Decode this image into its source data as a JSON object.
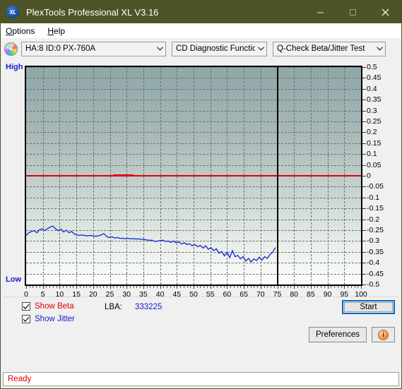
{
  "window": {
    "title": "PlexTools Professional XL V3.16",
    "app_icon": "xl-disc-icon",
    "minimize_label": "—",
    "maximize_label": "□",
    "close_label": "✕"
  },
  "menu": {
    "items": [
      {
        "label": "Options",
        "accel": "O"
      },
      {
        "label": "Help",
        "accel": "H"
      }
    ]
  },
  "toolbar": {
    "drive_icon": "cd-disc-icon",
    "drive_select": "HA:8 ID:0  PX-760A",
    "function_select": "CD Diagnostic Functions",
    "test_select": "Q-Check Beta/Jitter Test"
  },
  "chart_labels": {
    "high": "High",
    "low": "Low"
  },
  "controls": {
    "show_beta_label": "Show Beta",
    "show_beta_checked": true,
    "show_jitter_label": "Show Jitter",
    "show_jitter_checked": true,
    "lba_label": "LBA:",
    "lba_value": "333225",
    "start_label": "Start",
    "preferences_label": "Preferences",
    "info_label": "i"
  },
  "status": {
    "text": "Ready"
  },
  "colors": {
    "titlebar": "#4e5426",
    "beta_line": "#e00000",
    "jitter_line": "#1f2fd0",
    "label_blue": "#1818d0",
    "status_red": "#e00000",
    "plot_top": "#8fa7a8",
    "plot_bottom": "#fcfdfc"
  },
  "chart_data": {
    "type": "line",
    "title": "Q-Check Beta/Jitter Test",
    "xlabel": "",
    "ylabel": "",
    "xlim": [
      0,
      100
    ],
    "ylim": [
      -0.5,
      0.5
    ],
    "grid": true,
    "legend_position": "none",
    "xticks": [
      0,
      5,
      10,
      15,
      20,
      25,
      30,
      35,
      40,
      45,
      50,
      55,
      60,
      65,
      70,
      75,
      80,
      85,
      90,
      95,
      100
    ],
    "yticks": [
      0.5,
      0.45,
      0.4,
      0.35,
      0.3,
      0.25,
      0.2,
      0.15,
      0.1,
      0.05,
      0,
      -0.05,
      -0.1,
      -0.15,
      -0.2,
      -0.25,
      -0.3,
      -0.35,
      -0.4,
      -0.45,
      -0.5
    ],
    "annotations": [
      {
        "type": "vline",
        "x": 74.8,
        "color": "#000000",
        "label": "data-end-marker"
      }
    ],
    "series": [
      {
        "name": "Beta",
        "color": "#e00000",
        "type": "line",
        "x": [
          0,
          100
        ],
        "values": [
          0,
          0
        ],
        "note": "flat beta trace at 0 across full width"
      },
      {
        "name": "Jitter",
        "color": "#1f2fd0",
        "type": "line",
        "x": [
          0,
          0.8,
          1.6,
          2.4,
          3.2,
          4,
          4.8,
          5.6,
          6.4,
          7.2,
          8,
          8.8,
          9.6,
          10.4,
          11.2,
          12,
          12.8,
          13.6,
          14.4,
          15.2,
          16,
          16.8,
          17.6,
          18.4,
          19.2,
          20,
          20.8,
          21.6,
          22.4,
          23.2,
          24,
          24.8,
          25.6,
          26.4,
          27.2,
          28,
          28.8,
          29.6,
          30.4,
          31.2,
          32,
          32.8,
          33.6,
          34.4,
          35.2,
          36,
          36.8,
          37.6,
          38.4,
          39.2,
          40,
          40.8,
          41.6,
          42.4,
          43.2,
          44,
          44.8,
          45.6,
          46.4,
          47.2,
          48,
          48.8,
          49.6,
          50.4,
          51.2,
          52,
          52.8,
          53.6,
          54.4,
          55.2,
          56,
          56.8,
          57.6,
          58.4,
          59.2,
          60,
          60.8,
          61.6,
          62.4,
          63.2,
          64,
          64.8,
          65.6,
          66.4,
          67.2,
          68,
          68.8,
          69.6,
          70.4,
          71.2,
          72,
          72.8,
          73.6,
          74.4
        ],
        "values": [
          -0.275,
          -0.262,
          -0.256,
          -0.252,
          -0.262,
          -0.248,
          -0.244,
          -0.252,
          -0.243,
          -0.236,
          -0.231,
          -0.244,
          -0.252,
          -0.245,
          -0.258,
          -0.25,
          -0.262,
          -0.256,
          -0.268,
          -0.272,
          -0.274,
          -0.272,
          -0.275,
          -0.276,
          -0.274,
          -0.277,
          -0.278,
          -0.276,
          -0.272,
          -0.266,
          -0.278,
          -0.284,
          -0.28,
          -0.286,
          -0.284,
          -0.288,
          -0.287,
          -0.289,
          -0.288,
          -0.29,
          -0.289,
          -0.291,
          -0.29,
          -0.292,
          -0.293,
          -0.295,
          -0.297,
          -0.296,
          -0.302,
          -0.3,
          -0.298,
          -0.296,
          -0.302,
          -0.3,
          -0.306,
          -0.3,
          -0.308,
          -0.304,
          -0.314,
          -0.308,
          -0.316,
          -0.312,
          -0.322,
          -0.316,
          -0.326,
          -0.32,
          -0.332,
          -0.322,
          -0.338,
          -0.33,
          -0.344,
          -0.336,
          -0.356,
          -0.348,
          -0.368,
          -0.352,
          -0.376,
          -0.344,
          -0.372,
          -0.366,
          -0.382,
          -0.372,
          -0.392,
          -0.38,
          -0.396,
          -0.382,
          -0.39,
          -0.374,
          -0.388,
          -0.372,
          -0.38,
          -0.362,
          -0.352,
          -0.33
        ],
        "note": "jitter trace descending from about -0.27 to about -0.33, increasingly noisy toward the right"
      }
    ]
  }
}
